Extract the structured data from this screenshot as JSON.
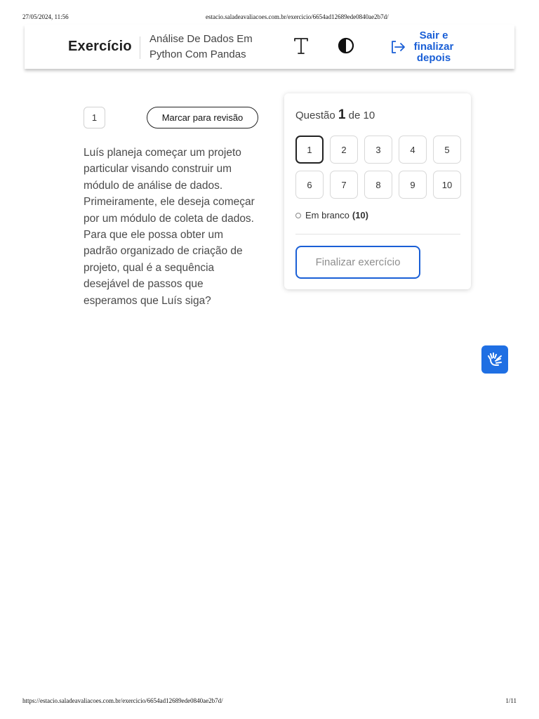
{
  "print_header": {
    "datetime": "27/05/2024, 11:56",
    "url": "estacio.saladeavaliacoes.com.br/exercicio/6654ad12689ede0840ae2b7d/"
  },
  "print_footer": {
    "url": "https://estacio.saladeavaliacoes.com.br/exercicio/6654ad12689ede0840ae2b7d/",
    "page": "1/11"
  },
  "header": {
    "title": "Exercício",
    "course_name": "Análise De Dados Em Python Com Pandas",
    "text_size_icon": "text-size-icon",
    "contrast_icon": "contrast-icon",
    "exit_icon": "exit-icon",
    "exit_label": "Sair e finalizar depois",
    "accent_color": "#1a5fd6"
  },
  "question": {
    "number": "1",
    "mark_review_label": "Marcar para revisão",
    "text": "Luís planeja começar um projeto particular visando construir um módulo de análise de dados. Primeiramente, ele deseja começar por um módulo de coleta de dados. Para que ele possa obter um padrão organizado de criação de projeto, qual é a sequência desejável de passos que esperamos que Luís siga?"
  },
  "navigator": {
    "heading_prefix": "Questão",
    "current": "1",
    "heading_suffix": "de 10",
    "questions": [
      "1",
      "2",
      "3",
      "4",
      "5",
      "6",
      "7",
      "8",
      "9",
      "10"
    ],
    "active_question": "1",
    "status_label": "Em branco",
    "status_count": "(10)",
    "finish_label": "Finalizar exercício"
  },
  "accessibility": {
    "icon": "sign-language-icon",
    "color": "#1f6fe3"
  }
}
